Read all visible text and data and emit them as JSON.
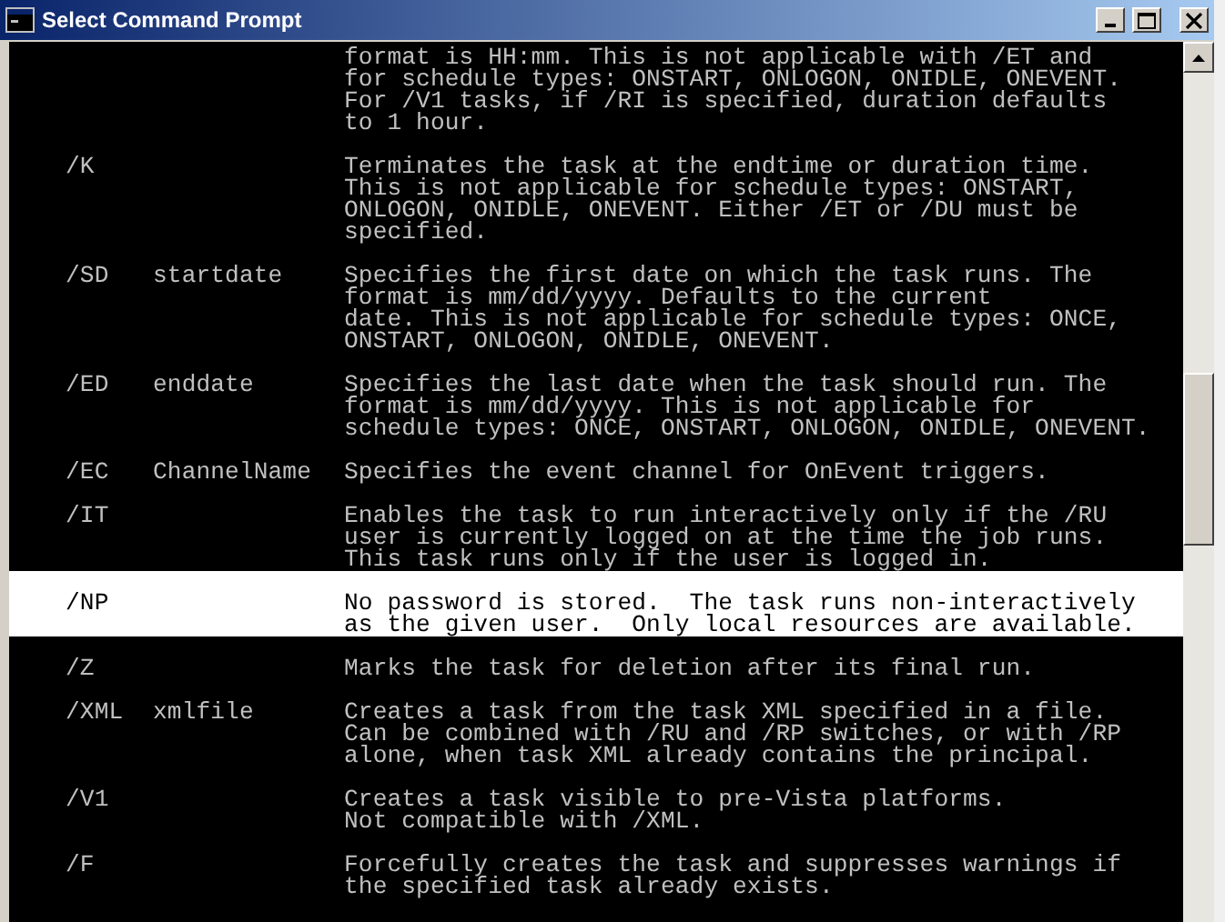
{
  "window": {
    "title": "Select Command Prompt"
  },
  "entries": [
    {
      "selected": false,
      "lines": [
        "format is HH:mm. This is not applicable with /ET and",
        "for schedule types: ONSTART, ONLOGON, ONIDLE, ONEVENT.",
        "For /V1 tasks, if /RI is specified, duration defaults",
        "to 1 hour."
      ]
    },
    {
      "switch": "/K",
      "selected": false,
      "lines": [
        "Terminates the task at the endtime or duration time.",
        "This is not applicable for schedule types: ONSTART,",
        "ONLOGON, ONIDLE, ONEVENT. Either /ET or /DU must be",
        "specified."
      ]
    },
    {
      "switch": "/SD",
      "argument": "startdate",
      "selected": false,
      "lines": [
        "Specifies the first date on which the task runs. The",
        "format is mm/dd/yyyy. Defaults to the current",
        "date. This is not applicable for schedule types: ONCE,",
        "ONSTART, ONLOGON, ONIDLE, ONEVENT."
      ]
    },
    {
      "switch": "/ED",
      "argument": "enddate",
      "selected": false,
      "lines": [
        "Specifies the last date when the task should run. The",
        "format is mm/dd/yyyy. This is not applicable for",
        "schedule types: ONCE, ONSTART, ONLOGON, ONIDLE, ONEVENT."
      ]
    },
    {
      "switch": "/EC",
      "argument": "ChannelName",
      "selected": false,
      "lines": [
        "Specifies the event channel for OnEvent triggers."
      ]
    },
    {
      "switch": "/IT",
      "selected": false,
      "lines": [
        "Enables the task to run interactively only if the /RU",
        "user is currently logged on at the time the job runs.",
        "This task runs only if the user is logged in."
      ]
    },
    {
      "switch": "/NP",
      "selected": true,
      "lines": [
        "No password is stored.  The task runs non-interactively",
        "as the given user.  Only local resources are available."
      ]
    },
    {
      "switch": "/Z",
      "selected": false,
      "lines": [
        "Marks the task for deletion after its final run."
      ]
    },
    {
      "switch": "/XML",
      "argument": "xmlfile",
      "selected": false,
      "lines": [
        "Creates a task from the task XML specified in a file.",
        "Can be combined with /RU and /RP switches, or with /RP",
        "alone, when task XML already contains the principal."
      ]
    },
    {
      "switch": "/V1",
      "selected": false,
      "lines": [
        "Creates a task visible to pre-Vista platforms.",
        "Not compatible with /XML."
      ]
    },
    {
      "switch": "/F",
      "selected": false,
      "lines": [
        "Forcefully creates the task and suppresses warnings if",
        "the specified task already exists."
      ]
    }
  ]
}
